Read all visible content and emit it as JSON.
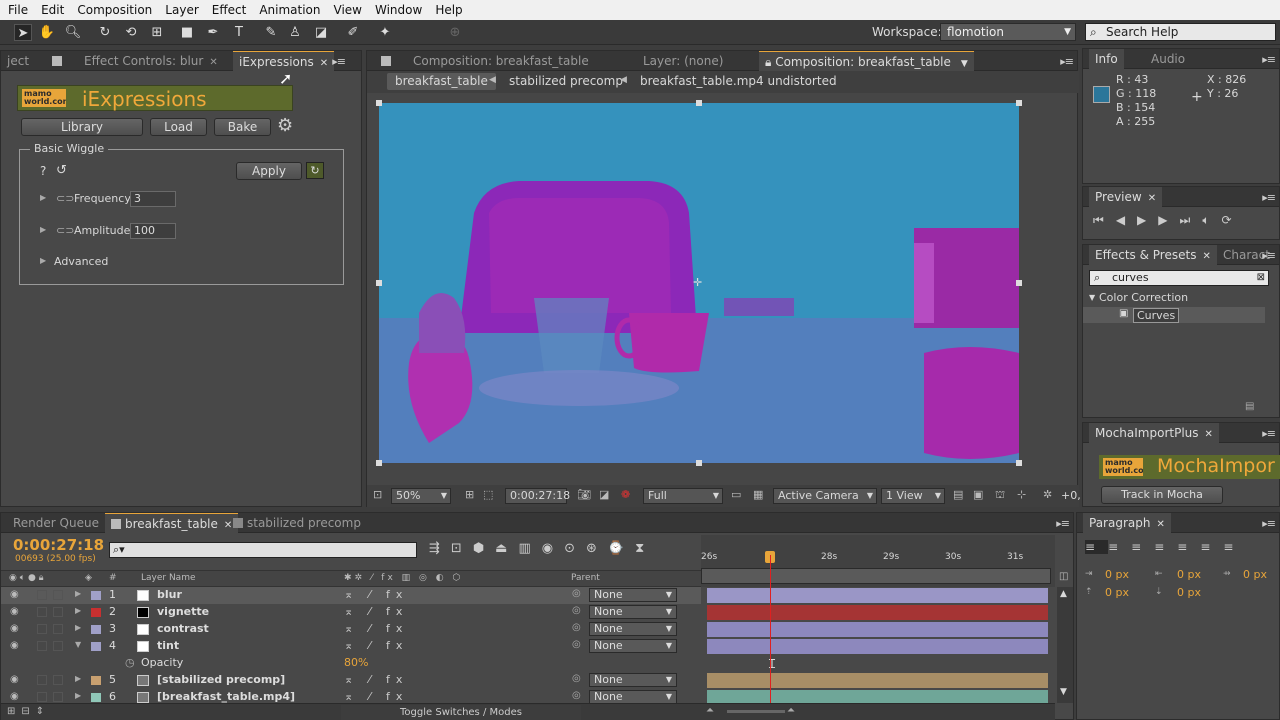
{
  "menu": [
    "File",
    "Edit",
    "Composition",
    "Layer",
    "Effect",
    "Animation",
    "View",
    "Window",
    "Help"
  ],
  "toolbar": {
    "workspace_label": "Workspace:",
    "workspace_value": "flomotion",
    "search_placeholder": "Search Help"
  },
  "left_panel": {
    "tabs": [
      "ject",
      "Effect Controls: blur",
      "iExpressions"
    ],
    "logo_small": "mamo world.com",
    "title": "iExpressions",
    "buttons": {
      "library": "Library",
      "load": "Load",
      "bake": "Bake",
      "apply": "Apply"
    },
    "group": "Basic Wiggle",
    "help": "?",
    "params": [
      {
        "name": "Frequency",
        "value": "3"
      },
      {
        "name": "Amplitude",
        "value": "100"
      }
    ],
    "advanced": "Advanced"
  },
  "comp_panel": {
    "tabs": [
      "Composition: breakfast_table",
      "Layer: (none)",
      "Composition: breakfast_table"
    ],
    "breadcrumbs": [
      "breakfast_table",
      "stabilized precomp",
      "breakfast_table.mp4 undistorted"
    ],
    "footer": {
      "zoom": "50%",
      "timecode": "0:00:27:18",
      "resolution": "Full",
      "camera": "Active Camera",
      "views": "1 View",
      "offset": "+0,"
    }
  },
  "info_panel": {
    "tabs": [
      "Info",
      "Audio"
    ],
    "r": "R : 43",
    "g": "G : 118",
    "b": "B : 154",
    "a": "A : 255",
    "x": "X : 826",
    "y": "Y : 26",
    "swatch": "#2b769a"
  },
  "preview_panel": {
    "tab": "Preview"
  },
  "effects_panel": {
    "tabs": [
      "Effects & Presets",
      "Charact"
    ],
    "search": "curves",
    "category": "Color Correction",
    "item": "Curves"
  },
  "mocha_panel": {
    "tab": "MochaImportPlus",
    "logo_small": "mamo world.com",
    "title": "MochaImpor",
    "button": "Track in Mocha"
  },
  "paragraph_panel": {
    "tab": "Paragraph",
    "fields": [
      "0 px",
      "0 px",
      "0 px",
      "0 px",
      "0 px"
    ]
  },
  "timeline": {
    "tabs": [
      "Render Queue",
      "breakfast_table",
      "stabilized precomp"
    ],
    "timecode": "0:00:27:18",
    "frames": "00693 (25.00 fps)",
    "col_layer": "Layer Name",
    "col_parent": "Parent",
    "col_num": "#",
    "ruler": [
      "26s",
      "28s",
      "29s",
      "30s",
      "31s"
    ],
    "layers": [
      {
        "num": "1",
        "name": "blur",
        "label": "#a0a0c8",
        "swatch": "#ffffff",
        "parent": "None",
        "bar": "#9a96c6"
      },
      {
        "num": "2",
        "name": "vignette",
        "label": "#c83030",
        "swatch": "#000000",
        "parent": "None",
        "bar": "#a53434"
      },
      {
        "num": "3",
        "name": "contrast",
        "label": "#a0a0c8",
        "swatch": "#ffffff",
        "parent": "None",
        "bar": "#8d88bd"
      },
      {
        "num": "4",
        "name": "tint",
        "label": "#a0a0c8",
        "swatch": "#ffffff",
        "parent": "None",
        "bar": "#8d88bd"
      },
      {
        "num": "5",
        "name": "[stabilized precomp]",
        "label": "#c8a070",
        "swatch": "#777",
        "parent": "None",
        "bar": "#a88e66"
      },
      {
        "num": "6",
        "name": "[breakfast_table.mp4]",
        "label": "#90c8b8",
        "swatch": "#777",
        "parent": "None",
        "bar": "#6fa698"
      }
    ],
    "opacity_label": "Opacity",
    "opacity_value": "80%",
    "toggle": "Toggle Switches / Modes"
  }
}
